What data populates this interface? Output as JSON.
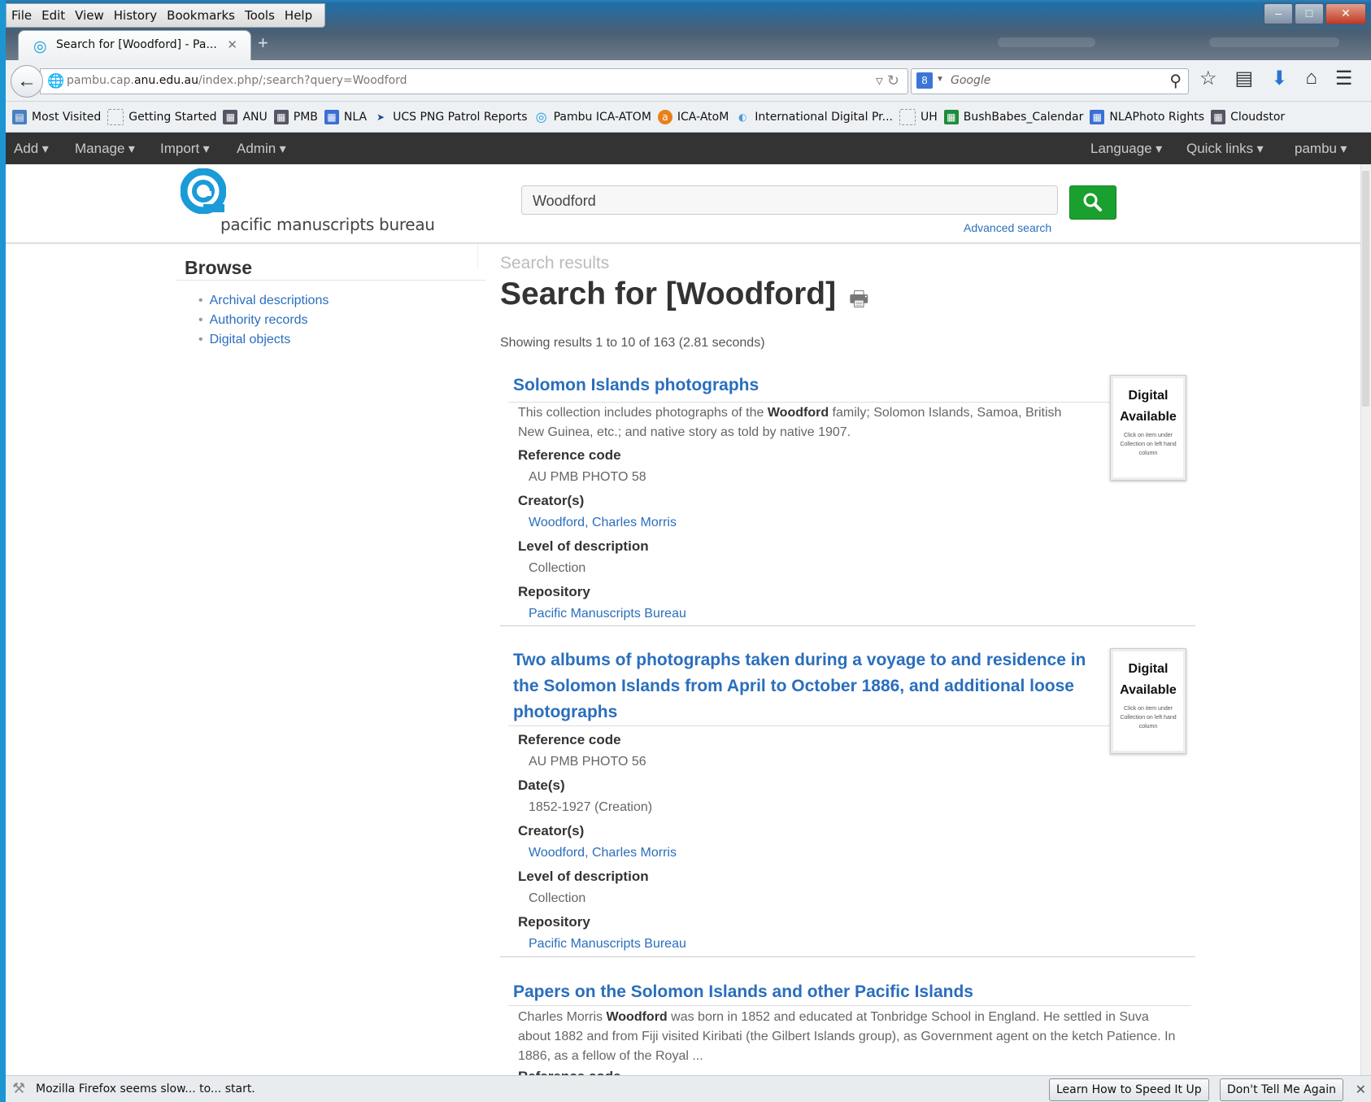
{
  "browser": {
    "menu": [
      "File",
      "Edit",
      "View",
      "History",
      "Bookmarks",
      "Tools",
      "Help"
    ],
    "tab_title": "Search for [Woodford] - Pa...",
    "url_host": "pambu.cap.",
    "url_domain": "anu.edu.au",
    "url_path": "/index.php/;search?query=Woodford",
    "search_placeholder": "Google",
    "bookmarks": [
      "Most Visited",
      "Getting Started",
      "ANU",
      "PMB",
      "NLA",
      "UCS PNG Patrol Reports",
      "Pambu ICA-ATOM",
      "ICA-AtoM",
      "International Digital Pr...",
      "UH",
      "BushBabes_Calendar",
      "NLAPhoto Rights",
      "Cloudstor"
    ]
  },
  "admin_bar": {
    "left": [
      "Add",
      "Manage",
      "Import",
      "Admin"
    ],
    "right": [
      "Language",
      "Quick links",
      "pambu"
    ]
  },
  "header": {
    "logo_text": "pacific manuscripts bureau",
    "search_value": "Woodford",
    "advanced_search": "Advanced search"
  },
  "sidebar": {
    "title": "Browse",
    "links": [
      "Archival descriptions",
      "Authority records",
      "Digital objects"
    ]
  },
  "main": {
    "breadcrumb": "Search results",
    "title": "Search for [Woodford]",
    "count": "Showing results 1 to 10 of 163 (2.81 seconds)"
  },
  "badge": {
    "line1": "Digital",
    "line2": "Available",
    "small": "Click on item under Collection on left hand column"
  },
  "results": [
    {
      "title": "Solomon Islands photographs",
      "summary_pre": "This collection includes photographs of the ",
      "summary_bold": "Woodford",
      "summary_post": " family; Solomon Islands, Samoa, British New Guinea, etc.; and native story as told by native 1907.",
      "ref_label": "Reference code",
      "ref": "AU PMB PHOTO 58",
      "creator_label": "Creator(s)",
      "creator": "Woodford, Charles Morris",
      "level_label": "Level of description",
      "level": "Collection",
      "repo_label": "Repository",
      "repo": "Pacific Manuscripts Bureau"
    },
    {
      "title_line1": "Two albums of photographs taken during a voyage to and residence in",
      "title_line2": "the Solomon Islands from April to October 1886, and additional loose",
      "title_line3": "photographs",
      "ref_label": "Reference code",
      "ref": "AU PMB PHOTO 56",
      "date_label": "Date(s)",
      "date": "1852-1927 (Creation)",
      "creator_label": "Creator(s)",
      "creator": "Woodford, Charles Morris",
      "level_label": "Level of description",
      "level": "Collection",
      "repo_label": "Repository",
      "repo": "Pacific Manuscripts Bureau"
    },
    {
      "title": "Papers on the Solomon Islands and other Pacific Islands",
      "summary_pre": "Charles Morris ",
      "summary_bold": "Woodford",
      "summary_post": " was born in 1852 and educated at Tonbridge School in England. He settled in Suva about 1882 and from Fiji visited Kiribati (the Gilbert Islands group), as Government agent on the ketch Patience. In 1886, as a fellow of the Royal ...",
      "ref_label": "Reference code"
    }
  ],
  "notification": {
    "message": "Mozilla Firefox seems slow... to... start.",
    "learn": "Learn How to Speed It Up",
    "dont": "Don't Tell Me Again"
  }
}
